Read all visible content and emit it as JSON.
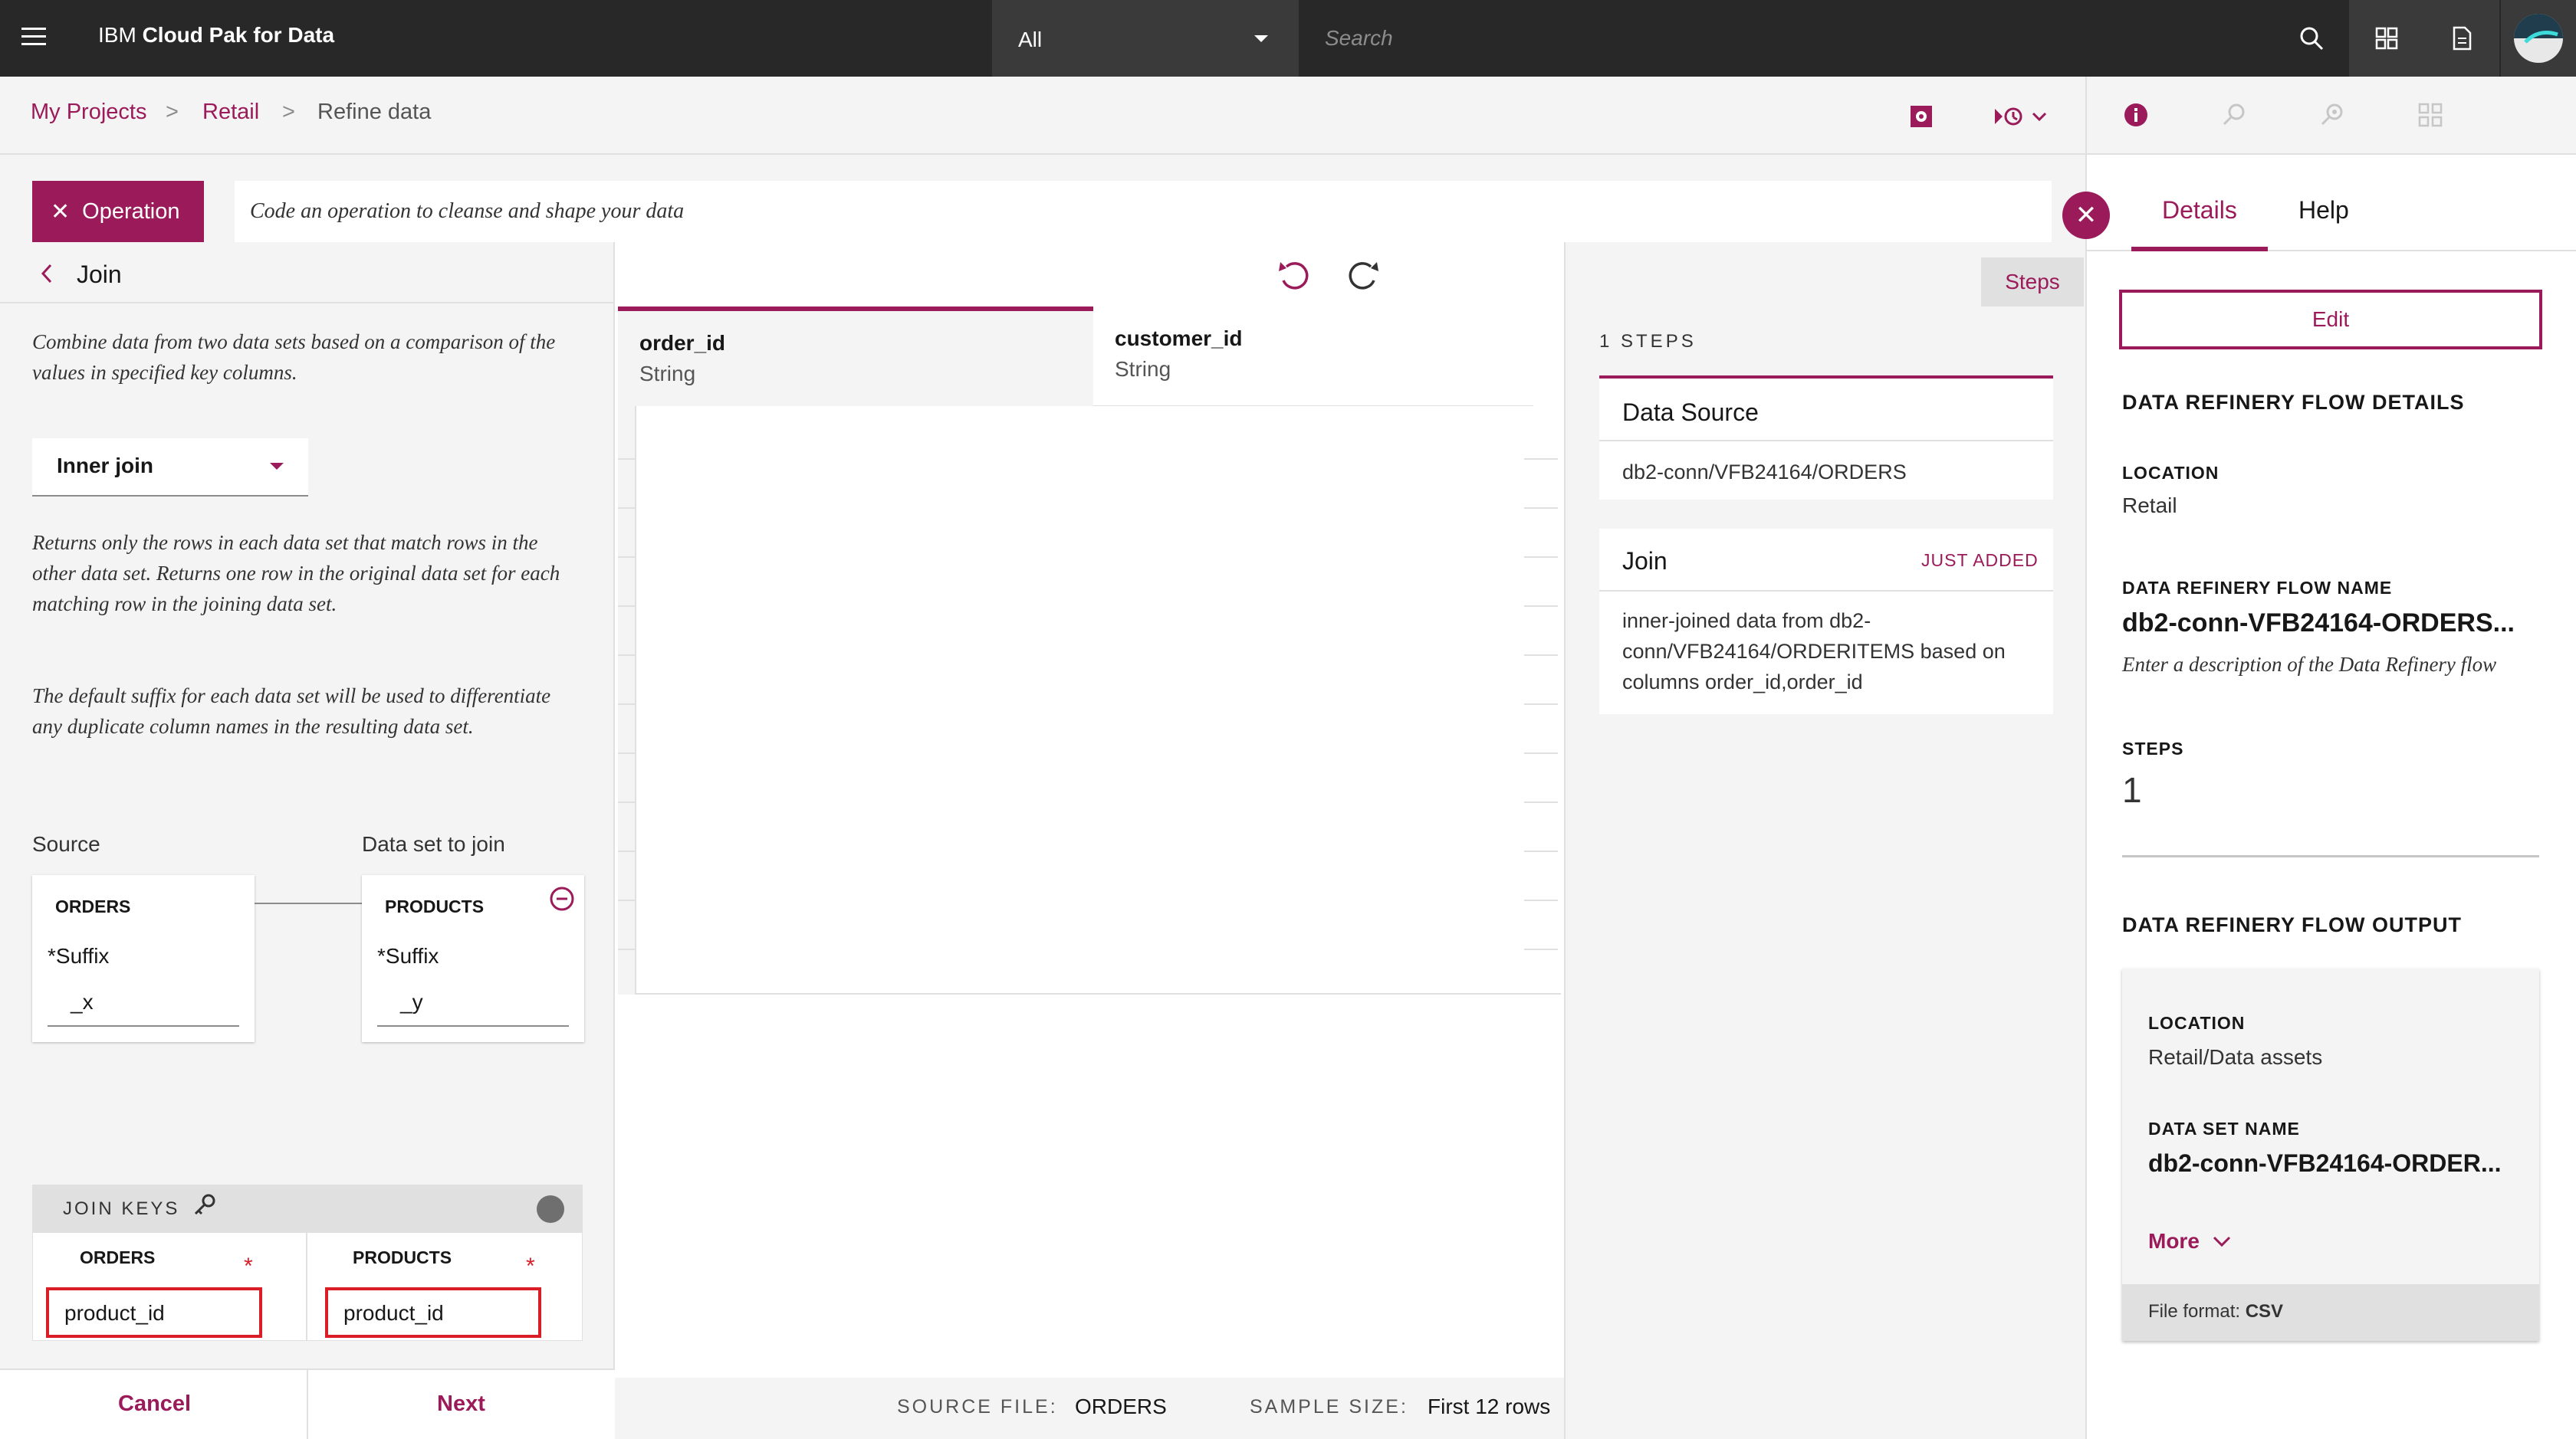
{
  "header": {
    "brand_light": "IBM ",
    "brand_bold": "Cloud Pak for Data",
    "scope_value": "All",
    "search_placeholder": "Search"
  },
  "breadcrumb": {
    "items": [
      "My Projects",
      "Retail",
      "Refine data"
    ],
    "separator": ">"
  },
  "operation": {
    "button_label": "Operation",
    "input_placeholder": "Code an operation to cleanse and shape your data"
  },
  "join_panel": {
    "title": "Join",
    "intro": "Combine data from two data sets based on a comparison of the values in specified key columns.",
    "join_type": "Inner join",
    "join_type_description": "Returns only the rows in each data set that match rows in the other data set. Returns one row in the original data set for each matching row in the joining data set.",
    "suffix_note": "The default suffix for each data set will be used to differentiate any duplicate column names in the resulting data set.",
    "source_label": "Source",
    "join_set_label": "Data set to join",
    "source": {
      "name": "ORDERS",
      "suffix_label": "*Suffix",
      "suffix_value": "_x"
    },
    "join_set": {
      "name": "PRODUCTS",
      "suffix_label": "*Suffix",
      "suffix_value": "_y"
    },
    "join_keys_label": "JOIN KEYS",
    "keys": {
      "left_header": "ORDERS",
      "right_header": "PRODUCTS",
      "required_mark": "*",
      "left_value": "product_id",
      "right_value": "product_id"
    },
    "cancel_label": "Cancel",
    "next_label": "Next"
  },
  "grid": {
    "columns": [
      {
        "name": "order_id",
        "type": "String"
      },
      {
        "name": "customer_id",
        "type": "String"
      }
    ]
  },
  "footer": {
    "source_file_label": "SOURCE FILE:",
    "source_file_value": "ORDERS",
    "sample_size_label": "SAMPLE SIZE:",
    "sample_size_value": "First 12 rows"
  },
  "steps": {
    "button_label": "Steps",
    "count_label": "1 STEPS",
    "items": [
      {
        "title": "Data Source",
        "badge": "",
        "description": "db2-conn/VFB24164/ORDERS"
      },
      {
        "title": "Join",
        "badge": "JUST ADDED",
        "description_lines": [
          "inner-joined data from db2-",
          "conn/VFB24164/ORDERITEMS based on",
          "columns order_id,order_id"
        ]
      }
    ]
  },
  "details": {
    "tabs": [
      "Details",
      "Help"
    ],
    "edit_label": "Edit",
    "flow_details_heading": "DATA REFINERY FLOW DETAILS",
    "location_label": "LOCATION",
    "location_value": "Retail",
    "flow_name_label": "DATA REFINERY FLOW NAME",
    "flow_name_value": "db2-conn-VFB24164-ORDERS...",
    "description_placeholder": "Enter a description of the Data Refinery flow",
    "steps_label": "STEPS",
    "steps_value": "1",
    "output_heading": "DATA REFINERY FLOW OUTPUT",
    "output_location_label": "LOCATION",
    "output_location_value": "Retail/Data assets",
    "dataset_name_label": "DATA SET NAME",
    "dataset_name_value": "db2-conn-VFB24164-ORDER...",
    "more_label": "More",
    "file_format_label": "File format: ",
    "file_format_value": "CSV"
  },
  "colors": {
    "accent": "#9b1b5a",
    "topbar": "#282828",
    "error": "#da1e28"
  }
}
